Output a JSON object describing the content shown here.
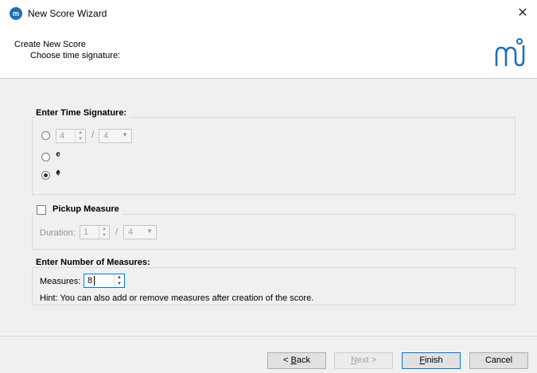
{
  "window": {
    "title": "New Score Wizard",
    "close": "✕"
  },
  "header": {
    "title": "Create New Score",
    "subtitle": "Choose time signature:"
  },
  "time_signature": {
    "group_label": "Enter Time Signature:",
    "numerator": "4",
    "separator": "/",
    "denominator": "4",
    "common_time_symbol": "𝄴",
    "cut_time_symbol": "𝄵",
    "selected": "cut_time"
  },
  "pickup": {
    "label": "Pickup Measure",
    "duration_label": "Duration:",
    "numerator": "1",
    "separator": "/",
    "denominator": "4"
  },
  "measures": {
    "group_label": "Enter Number of Measures:",
    "label": "Measures:",
    "value": "8",
    "hint": "Hint: You can also add or remove measures after creation of the score."
  },
  "buttons": {
    "back_mnemonic": "B",
    "back_rest": "ack",
    "back_prefix": "< ",
    "next_mnemonic": "N",
    "next_rest": "ext >",
    "finish_mnemonic": "F",
    "finish_rest": "inish",
    "cancel": "Cancel"
  },
  "colors": {
    "logo": "#1e6fb8",
    "accent": "#0078d7"
  }
}
